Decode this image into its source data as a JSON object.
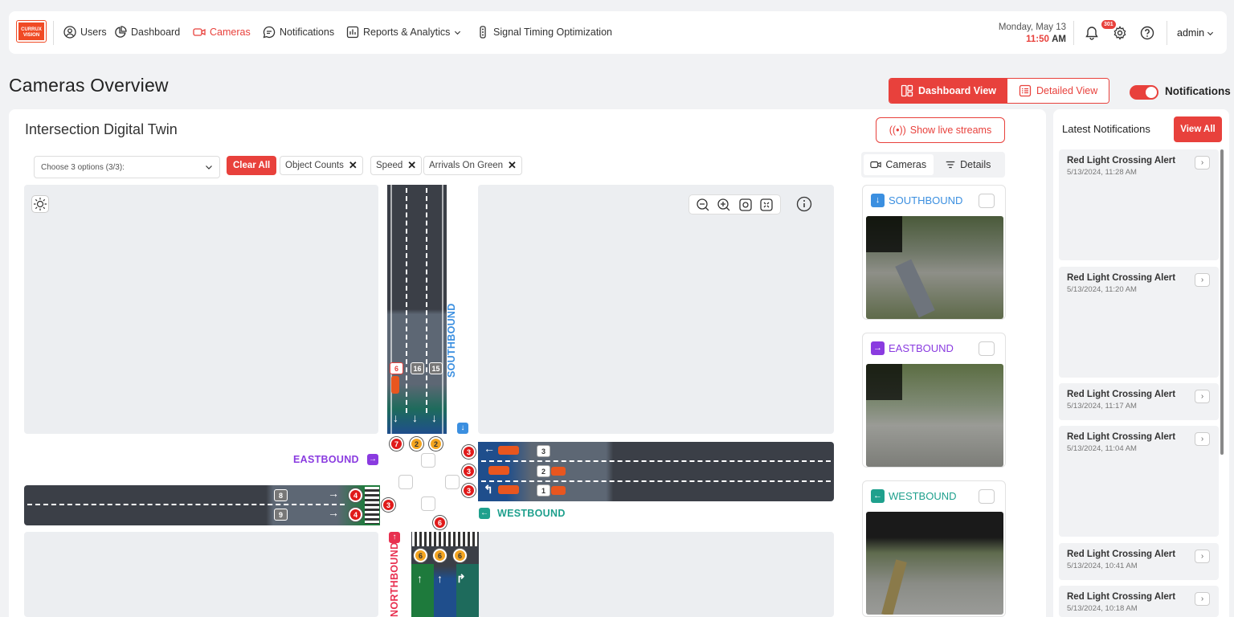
{
  "brand": {
    "logo_text": "CURRUX VISION"
  },
  "nav": [
    {
      "label": "Users",
      "icon": "user-circle-icon"
    },
    {
      "label": "Dashboard",
      "icon": "pie-chart-icon"
    },
    {
      "label": "Cameras",
      "icon": "video-camera-icon",
      "active": true
    },
    {
      "label": "Notifications",
      "icon": "message-icon"
    },
    {
      "label": "Reports & Analytics",
      "icon": "bar-chart-icon",
      "dropdown": true
    },
    {
      "label": "Signal Timing Optimization",
      "icon": "traffic-light-icon"
    }
  ],
  "header": {
    "date": "Monday, May 13",
    "time": "11:50",
    "ampm": "AM",
    "bell_count": "301",
    "user": "admin"
  },
  "page": {
    "title": "Cameras Overview",
    "view_dashboard": "Dashboard View",
    "view_detailed": "Detailed View",
    "notifications_toggle": "Notifications"
  },
  "panel": {
    "title": "Intersection Digital Twin",
    "live_streams": "Show live streams",
    "select_placeholder": "Choose 3 options (3/3):",
    "clear_all": "Clear All",
    "chips": [
      "Object Counts",
      "Speed",
      "Arrivals On Green"
    ],
    "tabs": {
      "cameras": "Cameras",
      "details": "Details"
    }
  },
  "map": {
    "directions": {
      "southbound": "SOUTHBOUND",
      "eastbound": "EASTBOUND",
      "westbound": "WESTBOUND",
      "northbound": "NORTHBOUND"
    },
    "south_counts": [
      "6",
      "16",
      "15"
    ],
    "south_circles": [
      "7",
      "2",
      "2"
    ],
    "west_counts": [
      "3",
      "2",
      "1"
    ],
    "west_circles": [
      "3",
      "3",
      "3"
    ],
    "east_counts": [
      "8",
      "9"
    ],
    "east_circles": [
      "4",
      "4",
      "3"
    ],
    "north_circle": "6",
    "north_lane_circles": [
      "6",
      "6",
      "6"
    ],
    "arrows": {
      "down": "↓",
      "right": "→",
      "left": "←",
      "uturn": "↰",
      "up": "↑",
      "up_right": "↱"
    }
  },
  "cameras": [
    {
      "label": "SOUTHBOUND",
      "color": "#3b8fe0",
      "icon": "↓"
    },
    {
      "label": "EASTBOUND",
      "color": "#8a3be0",
      "icon": "→"
    },
    {
      "label": "WESTBOUND",
      "color": "#1fa08d",
      "icon": "←"
    }
  ],
  "notifications": {
    "title": "Latest Notifications",
    "view_all": "View All",
    "items": [
      {
        "title": "Red Light Crossing Alert",
        "date": "5/13/2024, 11:28 AM"
      },
      {
        "title": "Red Light Crossing Alert",
        "date": "5/13/2024, 11:20 AM"
      },
      {
        "title": "Red Light Crossing Alert",
        "date": "5/13/2024, 11:17 AM"
      },
      {
        "title": "Red Light Crossing Alert",
        "date": "5/13/2024, 11:04 AM"
      },
      {
        "title": "Red Light Crossing Alert",
        "date": "5/13/2024, 10:41 AM"
      },
      {
        "title": "Red Light Crossing Alert",
        "date": "5/13/2024, 10:18 AM"
      }
    ]
  },
  "colors": {
    "accent": "#e8413c",
    "road": "#3b3f47",
    "southbound": "#3b8fe0",
    "eastbound": "#8a3be0",
    "westbound": "#1fa08d",
    "northbound": "#e83050"
  }
}
